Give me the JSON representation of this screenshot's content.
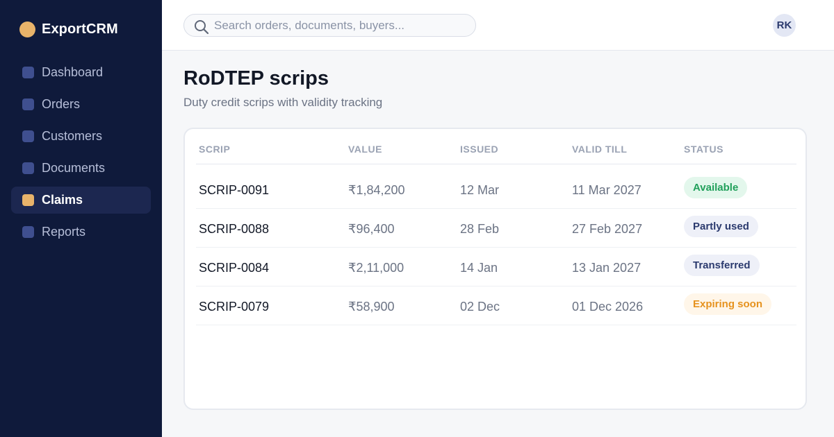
{
  "app": {
    "name": "ExportCRM"
  },
  "sidebar": {
    "items": [
      {
        "label": "Dashboard",
        "active": false
      },
      {
        "label": "Orders",
        "active": false
      },
      {
        "label": "Customers",
        "active": false
      },
      {
        "label": "Documents",
        "active": false
      },
      {
        "label": "Claims",
        "active": true
      },
      {
        "label": "Reports",
        "active": false
      }
    ]
  },
  "topbar": {
    "search_placeholder": "Search orders, documents, buyers...",
    "search_value": "",
    "avatar_initials": "RK"
  },
  "page": {
    "title": "RoDTEP scrips",
    "subtitle": "Duty credit scrips with validity tracking"
  },
  "table": {
    "columns": [
      "SCRIP",
      "VALUE",
      "ISSUED",
      "VALID TILL",
      "STATUS"
    ],
    "rows": [
      {
        "scrip": "SCRIP-0091",
        "value": "₹1,84,200",
        "issued": "12 Mar",
        "valid_till": "11 Mar 2027",
        "status": "Available"
      },
      {
        "scrip": "SCRIP-0088",
        "value": "₹96,400",
        "issued": "28 Feb",
        "valid_till": "27 Feb 2027",
        "status": "Partly used"
      },
      {
        "scrip": "SCRIP-0084",
        "value": "₹2,11,000",
        "issued": "14 Jan",
        "valid_till": "13 Jan 2027",
        "status": "Transferred"
      },
      {
        "scrip": "SCRIP-0079",
        "value": "₹58,900",
        "issued": "02 Dec",
        "valid_till": "01 Dec 2026",
        "status": "Expiring soon"
      }
    ]
  },
  "status_colors": {
    "Available": {
      "bg": "#e3f7ec",
      "fg": "#21a05b"
    },
    "Partly used": {
      "bg": "#eef0f8",
      "fg": "#2b3a6e"
    },
    "Transferred": {
      "bg": "#eef0f8",
      "fg": "#2b3a6e"
    },
    "Expiring soon": {
      "bg": "#fff6e9",
      "fg": "#e6921e"
    }
  },
  "colors": {
    "sidebar_bg": "#0f1a3b",
    "accent": "#e8b36a"
  }
}
